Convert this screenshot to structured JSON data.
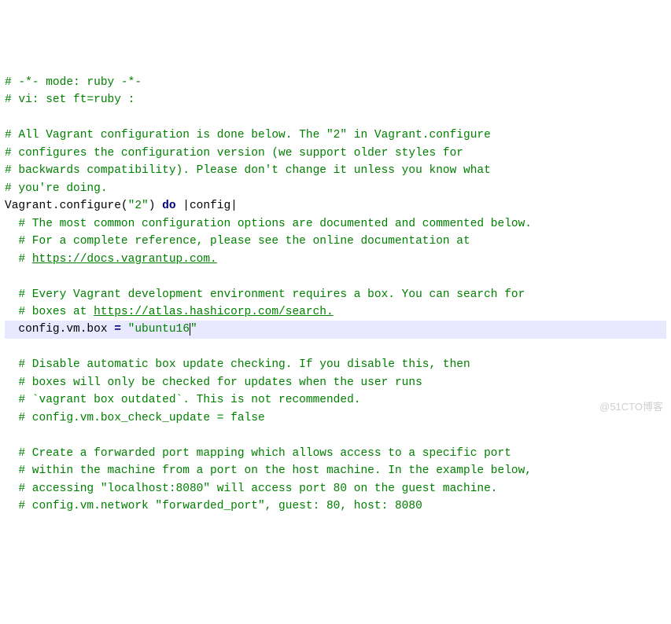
{
  "code": {
    "l1": "# -*- mode: ruby -*-",
    "l2": "# vi: set ft=ruby :",
    "l4a": "# All Vagrant configuration is done below. The \"2\" in Vagrant.configure",
    "l4b": "# configures the configuration version (we support older styles for",
    "l4c": "# backwards compatibility). Please don't change it unless you know what",
    "l4d": "# you're doing.",
    "l5a": "Vagrant.configure(",
    "l5b": "\"2\"",
    "l5c": ") ",
    "l5d": "do",
    "l5e": " |config|",
    "l6a": "  # The most common configuration options are documented and commented below.",
    "l6b": "  # For a complete reference, please see the online documentation at",
    "l6c1": "  # ",
    "l6c2": "https://docs.vagrantup.com.",
    "l7a": "  # Every Vagrant development environment requires a box. You can search for",
    "l7b1": "  # boxes at ",
    "l7b2": "https://atlas.hashicorp.com/search.",
    "l8a": "  config.vm.box ",
    "l8b": "=",
    "l8c": " ",
    "l8d": "\"ubuntu16",
    "l8e": "\"",
    "l9a": "  # Disable automatic box update checking. If you disable this, then",
    "l9b": "  # boxes will only be checked for updates when the user runs",
    "l9c": "  # `vagrant box outdated`. This is not recommended.",
    "l9d": "  # config.vm.box_check_update = false",
    "l10a": "  # Create a forwarded port mapping which allows access to a specific port",
    "l10b": "  # within the machine from a port on the host machine. In the example below,",
    "l10c": "  # accessing \"localhost:8080\" will access port 80 on the guest machine.",
    "l10d": "  # config.vm.network \"forwarded_port\", guest: 80, host: 8080"
  },
  "watermark": "@51CTO博客"
}
